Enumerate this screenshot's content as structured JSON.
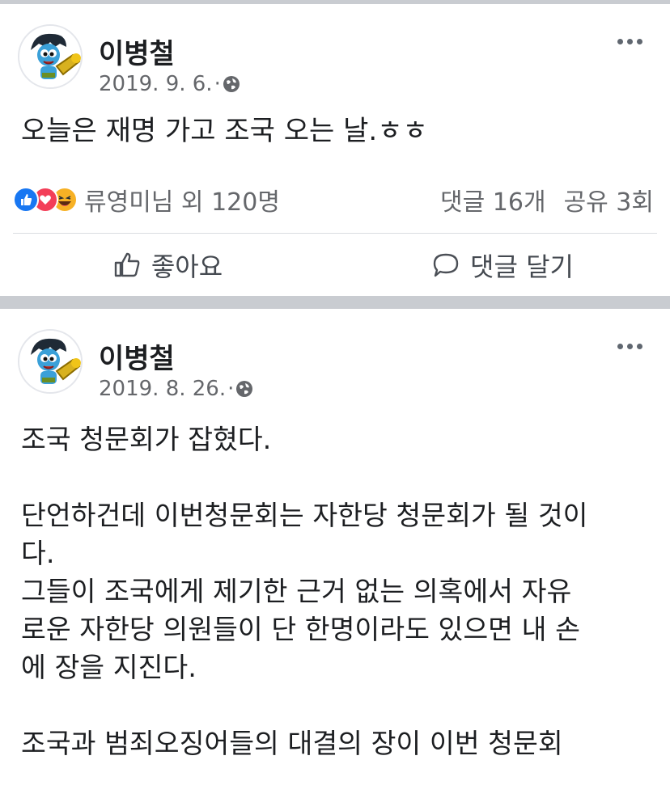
{
  "posts": [
    {
      "author": "이병철",
      "date": "2019. 9. 6.",
      "separator": "·",
      "body": "오늘은 재명 가고 조국 오는 날.ㅎㅎ",
      "reactors": "류영미님 외 120명",
      "comments": "댓글 16개",
      "shares": "공유 3회",
      "like_label": "좋아요",
      "comment_label": "댓글 달기"
    },
    {
      "author": "이병철",
      "date": "2019. 8. 26.",
      "separator": "·",
      "body_lines": [
        "조국 청문회가 잡혔다.",
        "",
        "단언하건데 이번청문회는 자한당 청문회가 될 것이",
        "다.",
        "그들이 조국에게 제기한 근거 없는 의혹에서 자유",
        "로운 자한당 의원들이 단 한명이라도 있으면 내 손",
        "에 장을 지진다.",
        "",
        "조국과 범죄오징어들의 대결의 장이 이번 청문회"
      ]
    }
  ],
  "icons": {
    "avatar": "avatar-cartoon-icon",
    "privacy": "globe-icon",
    "more": "more-options-icon",
    "reactions": [
      "like-reaction-icon",
      "love-reaction-icon",
      "haha-reaction-icon"
    ],
    "like_button": "thumbs-up-icon",
    "comment_button": "speech-bubble-icon"
  },
  "colors": {
    "like": "#1877f2",
    "love": "#f33e58",
    "haha": "#f7b125",
    "secondary_text": "#65676b",
    "separator_bg": "#c9ccd1"
  }
}
